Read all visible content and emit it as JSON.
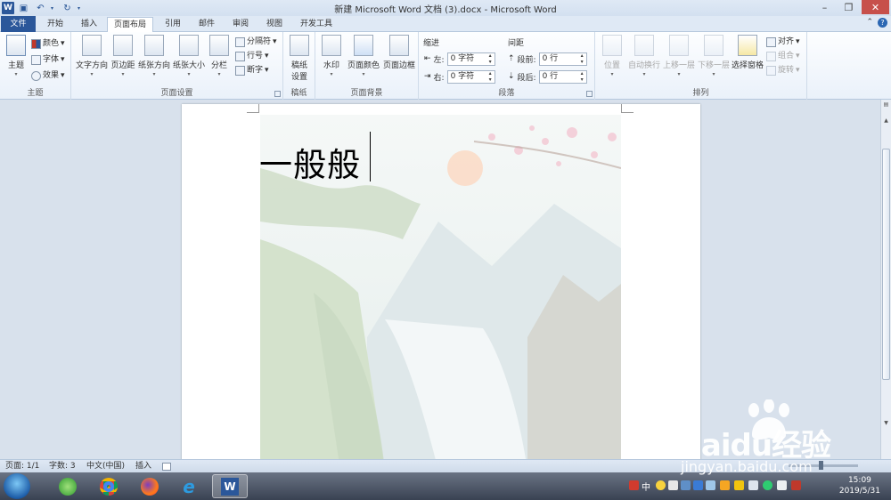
{
  "window": {
    "title": "新建 Microsoft Word 文档 (3).docx - Microsoft Word",
    "app_icon_label": "W"
  },
  "tabs": [
    "文件",
    "开始",
    "插入",
    "页面布局",
    "引用",
    "邮件",
    "审阅",
    "视图",
    "开发工具"
  ],
  "ribbon": {
    "theme": {
      "label": "主题",
      "button": "主题",
      "colors": "颜色",
      "fonts": "字体",
      "effects": "效果"
    },
    "page_setup": {
      "label": "页面设置",
      "text_direction": "文字方向",
      "margins": "页边距",
      "orientation": "纸张方向",
      "size": "纸张大小",
      "columns": "分栏",
      "breaks": "分隔符",
      "line_numbers": "行号",
      "hyphenation": "断字"
    },
    "manuscript": {
      "label": "稿纸",
      "button_line1": "稿纸",
      "button_line2": "设置"
    },
    "page_background": {
      "label": "页面背景",
      "watermark": "水印",
      "page_color": "页面颜色",
      "page_borders": "页面边框"
    },
    "paragraph": {
      "label": "段落",
      "indent_title": "缩进",
      "spacing_title": "间距",
      "left_label": "左:",
      "left_value": "0 字符",
      "right_label": "右:",
      "right_value": "0 字符",
      "before_label": "段前:",
      "before_value": "0 行",
      "after_label": "段后:",
      "after_value": "0 行"
    },
    "arrange": {
      "label": "排列",
      "position": "位置",
      "wrap_text": "自动换行",
      "bring_forward": "上移一层",
      "send_backward": "下移一层",
      "selection_pane": "选择窗格",
      "align": "对齐",
      "group": "组合",
      "rotate": "旋转"
    }
  },
  "document": {
    "text": "一般般"
  },
  "statusbar": {
    "page": "页面: 1/1",
    "words": "字数: 3",
    "language": "中文(中国)",
    "insert_mode": "插入",
    "zoom_percent": 0.46
  },
  "taskbar": {
    "clock_time": "15:09",
    "clock_date": "2019/5/31",
    "ime": "中"
  },
  "watermark": {
    "brand": "Baidu经验",
    "url": "jingyan.baidu.com"
  },
  "colors": {
    "word_blue": "#2b579a",
    "ribbon_bg": "#eaf1fa",
    "doc_bg": "#d8e1ec"
  }
}
